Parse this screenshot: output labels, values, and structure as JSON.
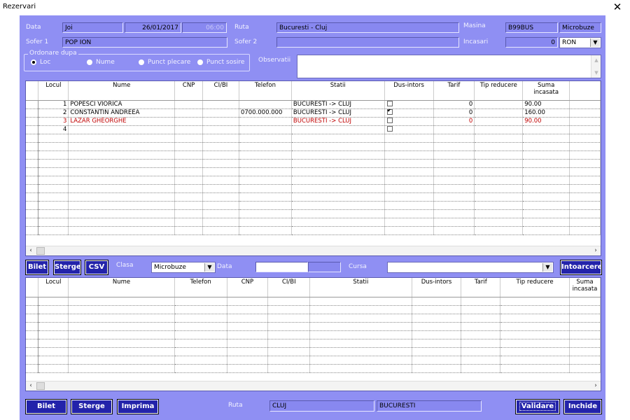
{
  "window": {
    "title": "Rezervari",
    "close": "✕"
  },
  "header": {
    "data_label": "Data",
    "day": "Joi",
    "date": "26/01/2017",
    "time": "06:00",
    "ruta_label": "Ruta",
    "ruta": "Bucuresti - Cluj",
    "masina_label": "Masina",
    "masina": "B99BUS",
    "masina_type": "Microbuze",
    "sofer1_label": "Sofer 1",
    "sofer1": "POP ION",
    "sofer2_label": "Sofer 2",
    "sofer2": "",
    "incasari_label": "Incasari",
    "incasari": "0",
    "currency": "RON"
  },
  "ordering": {
    "label": "Ordonare dupa",
    "options": [
      "Loc",
      "Nume",
      "Punct plecare",
      "Punct sosire"
    ],
    "selected": "Loc"
  },
  "observatii_label": "Observatii",
  "top_grid": {
    "columns": [
      "Locul",
      "Nume",
      "CNP",
      "CI/BI",
      "Telefon",
      "Statii",
      "Dus-intors",
      "Tarif",
      "Tip reducere",
      "Suma incasata"
    ],
    "rows": [
      {
        "loc": "1",
        "nume": "POPESCI VIORICA",
        "cnp": "",
        "ci": "",
        "tel": "",
        "statii": "BUCURESTI -> CLUJ",
        "dus": false,
        "tarif": "0",
        "tip": "",
        "suma": "90.00",
        "red": false
      },
      {
        "loc": "2",
        "nume": "CONSTANTIN ANDREEA",
        "cnp": "",
        "ci": "",
        "tel": "0700.000.000",
        "statii": "BUCURESTI -> CLUJ",
        "dus": true,
        "tarif": "0",
        "tip": "",
        "suma": "160.00",
        "red": false
      },
      {
        "loc": "3",
        "nume": "LAZAR GHEORGHE",
        "cnp": "",
        "ci": "",
        "tel": "",
        "statii": "BUCURESTI -> CLUJ",
        "dus": false,
        "tarif": "0",
        "tip": "",
        "suma": "90.00",
        "red": true
      },
      {
        "loc": "4",
        "nume": "",
        "cnp": "",
        "ci": "",
        "tel": "",
        "statii": "",
        "dus": false,
        "tarif": "",
        "tip": "",
        "suma": "",
        "red": false
      }
    ]
  },
  "middle": {
    "bilet": "Bilet",
    "sterge": "Sterge",
    "csv": "CSV",
    "clasa_label": "Clasa",
    "clasa": "Microbuze",
    "data_label": "Data",
    "cursa_label": "Cursa",
    "cursa": "",
    "intoarcere": "Intoarcere"
  },
  "bottom_grid": {
    "columns": [
      "Locul",
      "Nume",
      "Telefon",
      "CNP",
      "CI/BI",
      "Statii",
      "Dus-intors",
      "Tarif",
      "Tip reducere",
      "Suma incasata"
    ]
  },
  "footer": {
    "bilet": "Bilet",
    "sterge": "Sterge",
    "imprima": "Imprima",
    "ruta_label": "Ruta",
    "from": "CLUJ",
    "to": "BUCURESTI",
    "validare": "Validare",
    "inchide": "Inchide"
  },
  "colors": {
    "form_bg": "#8f8ff3",
    "button_dark": "#2323aa",
    "row_red": "#c00000"
  }
}
